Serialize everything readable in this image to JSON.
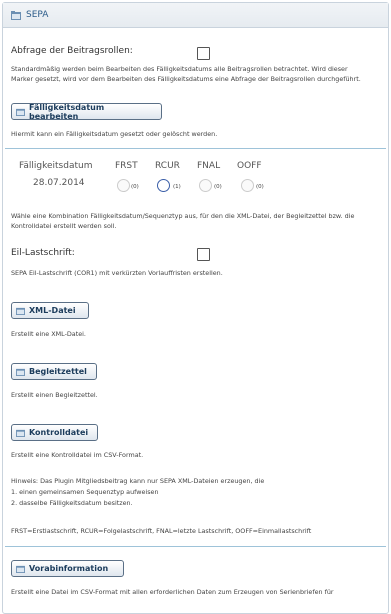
{
  "header": {
    "title": "SEPA"
  },
  "abfrage": {
    "label": "Abfrage der Beitragsrollen:",
    "help1": "Standardmäßig werden beim Bearbeiten des Fälligkeitsdatums alle Beitragsrollen betrachtet. Wird dieser",
    "help2": "Marker gesetzt, wird vor dem Bearbeiten des Fälligkeitsdatums eine Abfrage der Beitragsrollen durchgeführt."
  },
  "faelligkeit_button": {
    "label": "Fälligkeitsdatum bearbeiten",
    "help": "Hiermit kann ein Fälligkeitsdatum gesetzt oder gelöscht werden."
  },
  "sequenz": {
    "date_header": "Fälligkeitsdatum",
    "date_value": "28.07.2014",
    "columns": [
      {
        "label": "FRST",
        "count": "(0)"
      },
      {
        "label": "RCUR",
        "count": "(1)"
      },
      {
        "label": "FNAL",
        "count": "(0)"
      },
      {
        "label": "OOFF",
        "count": "(0)"
      }
    ],
    "help1": "Wähle eine Kombination Fälligkeitsdatum/Sequenztyp aus, für den die XML-Datei, der Begleitzettel bzw. die",
    "help2": "Kontrolldatei erstellt werden soll."
  },
  "eil": {
    "label": "Eil-Lastschrift:",
    "help": "SEPA Eil-Lastschrift (COR1) mit verkürzten Vorlauffristen erstellen."
  },
  "xml": {
    "label": "XML-Datei",
    "help": "Erstellt eine XML-Datei."
  },
  "begleit": {
    "label": "Begleitzettel",
    "help": "Erstellt einen Begleitzettel."
  },
  "kontroll": {
    "label": "Kontrolldatei",
    "help": "Erstellt eine Kontrolldatei im CSV-Format."
  },
  "hinweis": {
    "line1": "Hinweis: Das Plugin Mitgliedsbeitrag kann nur SEPA XML-Dateien erzeugen, die",
    "line2": "1. einen gemeinsamen Sequenztyp aufweisen",
    "line3": "2. dasselbe Fälligkeitsdatum besitzen."
  },
  "legend": "FRST=Erstlastschrift, RCUR=Folgelastschrift, FNAL=letzte Lastschrift, OOFF=Einmallastschrift",
  "vorab": {
    "label": "Vorabinformation",
    "help": "Erstellt eine Datei im CSV-Format mit allen erforderlichen Daten zum Erzeugen von Serienbriefen für"
  }
}
